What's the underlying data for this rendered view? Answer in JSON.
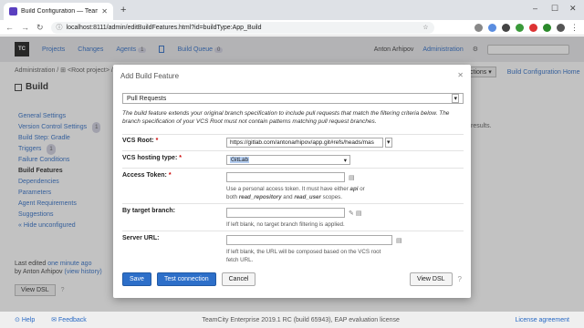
{
  "browser": {
    "tab_title": "Build Configuration — TeamCity",
    "url": "localhost:8111/admin/editBuildFeatures.html?id=buildType:App_Build"
  },
  "tc": {
    "logo": "TC",
    "nav": [
      {
        "label": "Projects"
      },
      {
        "label": "Changes"
      },
      {
        "label": "Agents",
        "count": "1"
      },
      {
        "label": "Build Queue",
        "count": "0"
      }
    ],
    "user": "Anton Arhipov",
    "admin": "Administration"
  },
  "page": {
    "breadcrumb": "Administration  /  ⊞ <Root project>  /",
    "title": "Build",
    "actions_label": "ctions ▾",
    "config_home": "Build Configuration Home",
    "results_fragment": "results."
  },
  "sidebar": {
    "items": [
      {
        "label": "General Settings"
      },
      {
        "label": "Version Control Settings",
        "count": "1"
      },
      {
        "label": "Build Step: Gradle"
      },
      {
        "label": "Triggers",
        "count": "1"
      },
      {
        "label": "Failure Conditions"
      },
      {
        "label": "Build Features"
      },
      {
        "label": "Dependencies"
      },
      {
        "label": "Parameters"
      },
      {
        "label": "Agent Requirements"
      },
      {
        "label": "Suggestions"
      },
      {
        "label": "« Hide unconfigured"
      }
    ],
    "last_edited_prefix": "Last edited",
    "last_edited_time": "one minute ago",
    "last_edited_by": "by Anton Arhipov",
    "view_history": "(view history)",
    "view_dsl": "View DSL"
  },
  "footer": {
    "help": "Help",
    "feedback": "Feedback",
    "version": "TeamCity Enterprise 2019.1 RC (build 65943), EAP evaluation license",
    "license": "License agreement"
  },
  "dialog": {
    "title": "Add Build Feature",
    "feature_select": "Pull Requests",
    "description": "The build feature extends your original branch specification to include pull requests that match the filtering criteria below. The branch specification of your VCS Root must not contain patterns matching pull request branches.",
    "vcs_root_label": "VCS Root:",
    "vcs_root_value": "https://gitlab.com/antonarhipov/app.git#refs/heads/mas",
    "hosting_label": "VCS hosting type:",
    "hosting_value": "GitLab",
    "token_label": "Access Token:",
    "token_hint_1": "Use a personal access token. It must have either ",
    "token_hint_api": "api",
    "token_hint_2": " or",
    "token_hint_3": "both ",
    "token_hint_rr": "read_repository",
    "token_hint_4": " and ",
    "token_hint_ru": "read_user",
    "token_hint_5": " scopes.",
    "branch_label": "By target branch:",
    "branch_hint": "If left blank, no target branch filtering is applied.",
    "server_label": "Server URL:",
    "server_hint": "If left blank, the URL will be composed based on the VCS root fetch URL.",
    "save": "Save",
    "test": "Test connection",
    "cancel": "Cancel",
    "view_dsl": "View DSL"
  },
  "colors": {
    "link": "#2768c4",
    "primary": "#2d6fc9"
  }
}
